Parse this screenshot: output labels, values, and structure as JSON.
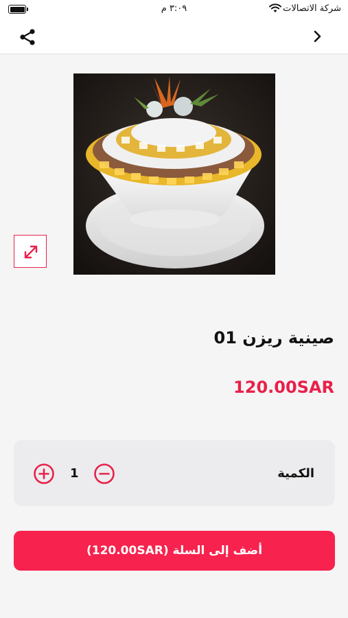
{
  "status_bar": {
    "carrier": "شركة الاتصالات",
    "time": "٣:٠٩ م"
  },
  "nav": {
    "share_icon": "share-icon",
    "back_icon": "chevron-right-icon"
  },
  "product": {
    "title": "صينية ريزن 01",
    "price": "120.00SAR",
    "zoom_icon": "expand-icon"
  },
  "quantity": {
    "label": "الكمية",
    "value": "1",
    "plus_icon": "plus-circle-icon",
    "minus_icon": "minus-circle-icon"
  },
  "add_to_cart": {
    "label": "أضف إلى السلة (120.00SAR)"
  },
  "colors": {
    "accent": "#f7224d",
    "background": "#f5f5f5",
    "card": "#ececee"
  }
}
